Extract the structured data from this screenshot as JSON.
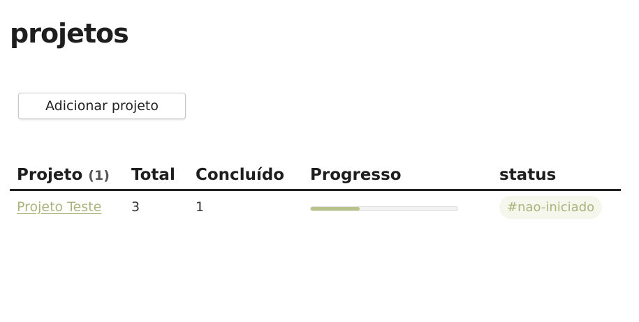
{
  "page": {
    "title": "projetos"
  },
  "actions": {
    "add_project_label": "Adicionar projeto"
  },
  "table": {
    "columns": {
      "project": "Projeto",
      "project_count": "(1)",
      "total": "Total",
      "done": "Concluído",
      "progress": "Progresso",
      "status": "status"
    },
    "rows": [
      {
        "name": "Projeto Teste",
        "total": "3",
        "done": "1",
        "progress": 0.333,
        "status": "#nao-iniciado"
      }
    ]
  },
  "colors": {
    "accent": "#a9b57d",
    "progress_fill": "#b8c389",
    "tag_background": "#f5f6ec"
  }
}
